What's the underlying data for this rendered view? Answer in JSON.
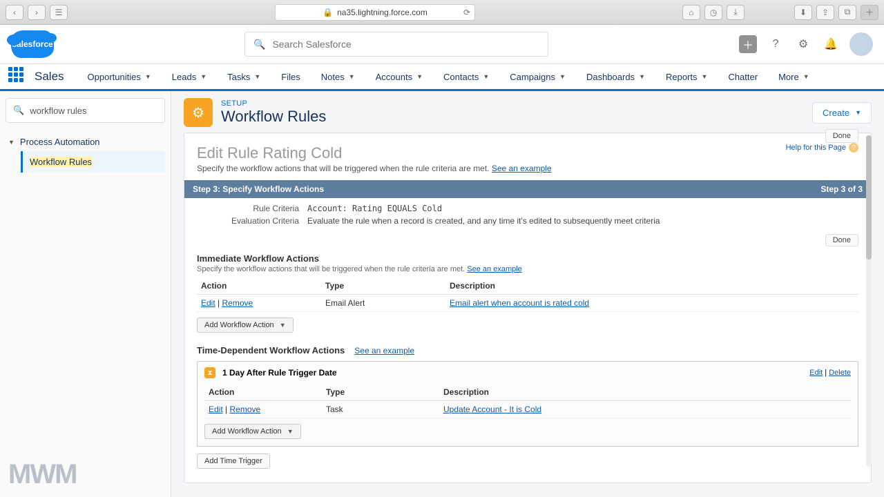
{
  "browser": {
    "url": "na35.lightning.force.com"
  },
  "sf": {
    "logo": "salesforce"
  },
  "header": {
    "search_placeholder": "Search Salesforce"
  },
  "nav": {
    "app": "Sales",
    "items": [
      "Opportunities",
      "Leads",
      "Tasks",
      "Files",
      "Notes",
      "Accounts",
      "Contacts",
      "Campaigns",
      "Dashboards",
      "Reports",
      "Chatter",
      "More"
    ]
  },
  "sidebar": {
    "search": "workflow rules",
    "parent": "Process Automation",
    "child": "Workflow Rules"
  },
  "setup": {
    "eyebrow": "SETUP",
    "title": "Workflow Rules",
    "create": "Create"
  },
  "page": {
    "help": "Help for this Page",
    "done": "Done",
    "editTitle": "Edit Rule Rating Cold",
    "editSub": "Specify the workflow actions that will be triggered when the rule criteria are met. ",
    "seeExample": "See an example",
    "step": {
      "left": "Step 3: Specify Workflow Actions",
      "right": "Step 3 of 3"
    },
    "criteria": {
      "ruleLbl": "Rule Criteria",
      "ruleVal": "Account: Rating EQUALS Cold",
      "evalLbl": "Evaluation Criteria",
      "evalVal": "Evaluate the rule when a record is created, and any time it's edited to subsequently meet criteria"
    },
    "immediate": {
      "hdr": "Immediate Workflow Actions",
      "sub": "Specify the workflow actions that will be triggered when the rule criteria are met. ",
      "cols": {
        "action": "Action",
        "type": "Type",
        "desc": "Description"
      },
      "row": {
        "edit": "Edit",
        "remove": "Remove",
        "type": "Email Alert",
        "desc": "Email alert when account is rated cold"
      },
      "add": "Add Workflow Action"
    },
    "time": {
      "hdr": "Time-Dependent Workflow Actions",
      "boxTitle": "1 Day After Rule Trigger Date",
      "edit": "Edit",
      "delete": "Delete",
      "cols": {
        "action": "Action",
        "type": "Type",
        "desc": "Description"
      },
      "row": {
        "edit": "Edit",
        "remove": "Remove",
        "type": "Task",
        "desc": "Update Account - It is Cold"
      },
      "add": "Add Workflow Action",
      "addTrigger": "Add Time Trigger"
    }
  },
  "watermark": "MWM"
}
